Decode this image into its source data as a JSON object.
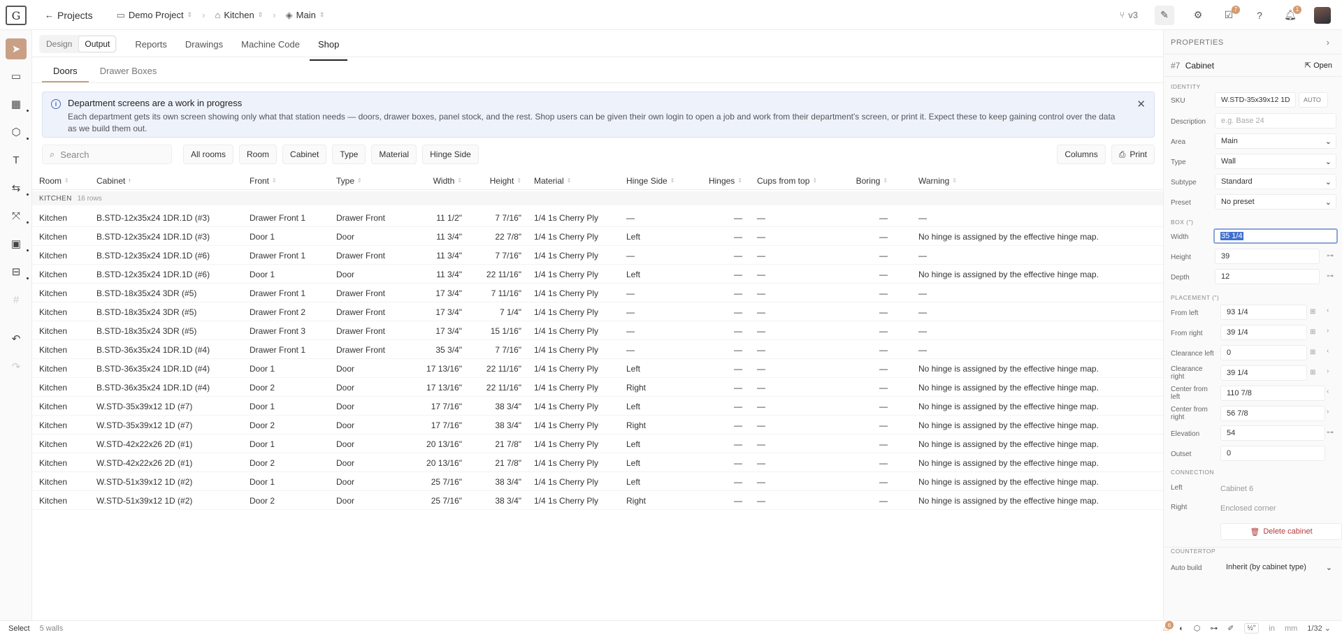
{
  "topbar": {
    "logo": "G",
    "back_label": "Projects",
    "crumbs": [
      "Demo Project",
      "Kitchen",
      "Main"
    ],
    "version": "v3",
    "checklist_badge": "7",
    "notif_badge": "1"
  },
  "toggle": [
    "Design",
    "Output"
  ],
  "tabs": [
    "Reports",
    "Drawings",
    "Machine Code",
    "Shop"
  ],
  "subtabs": [
    "Doors",
    "Drawer Boxes"
  ],
  "banner": {
    "title": "Department screens are a work in progress",
    "text": "Each department gets its own screen showing only what that station needs — doors, drawer boxes, panel stock, and the rest. Shop users can be given their own login to open a job and work from their department's screen, or print it. Expect these to keep gaining control over the data as we build them out."
  },
  "filters": {
    "search_placeholder": "Search",
    "buttons": [
      "All rooms",
      "Room",
      "Cabinet",
      "Type",
      "Material",
      "Hinge Side"
    ],
    "columns_label": "Columns",
    "print_label": "Print"
  },
  "table": {
    "headers": [
      "Room",
      "Cabinet",
      "Front",
      "Type",
      "Width",
      "Height",
      "Material",
      "Hinge Side",
      "Hinges",
      "Cups from top",
      "Boring",
      "Warning"
    ],
    "group": {
      "name": "KITCHEN",
      "count": "16 rows"
    },
    "rows": [
      [
        "Kitchen",
        "B.STD-12x35x24 1DR.1D (#3)",
        "Drawer Front 1",
        "Drawer Front",
        "11 1/2\"",
        "7 7/16\"",
        "1/4 1s Cherry Ply",
        "—",
        "—",
        "—",
        "—",
        "—"
      ],
      [
        "Kitchen",
        "B.STD-12x35x24 1DR.1D (#3)",
        "Door 1",
        "Door",
        "11 3/4\"",
        "22 7/8\"",
        "1/4 1s Cherry Ply",
        "Left",
        "—",
        "—",
        "—",
        "No hinge is assigned by the effective hinge map."
      ],
      [
        "Kitchen",
        "B.STD-12x35x24 1DR.1D (#6)",
        "Drawer Front 1",
        "Drawer Front",
        "11 3/4\"",
        "7 7/16\"",
        "1/4 1s Cherry Ply",
        "—",
        "—",
        "—",
        "—",
        "—"
      ],
      [
        "Kitchen",
        "B.STD-12x35x24 1DR.1D (#6)",
        "Door 1",
        "Door",
        "11 3/4\"",
        "22 11/16\"",
        "1/4 1s Cherry Ply",
        "Left",
        "—",
        "—",
        "—",
        "No hinge is assigned by the effective hinge map."
      ],
      [
        "Kitchen",
        "B.STD-18x35x24 3DR (#5)",
        "Drawer Front 1",
        "Drawer Front",
        "17 3/4\"",
        "7 11/16\"",
        "1/4 1s Cherry Ply",
        "—",
        "—",
        "—",
        "—",
        "—"
      ],
      [
        "Kitchen",
        "B.STD-18x35x24 3DR (#5)",
        "Drawer Front 2",
        "Drawer Front",
        "17 3/4\"",
        "7 1/4\"",
        "1/4 1s Cherry Ply",
        "—",
        "—",
        "—",
        "—",
        "—"
      ],
      [
        "Kitchen",
        "B.STD-18x35x24 3DR (#5)",
        "Drawer Front 3",
        "Drawer Front",
        "17 3/4\"",
        "15 1/16\"",
        "1/4 1s Cherry Ply",
        "—",
        "—",
        "—",
        "—",
        "—"
      ],
      [
        "Kitchen",
        "B.STD-36x35x24 1DR.1D (#4)",
        "Drawer Front 1",
        "Drawer Front",
        "35 3/4\"",
        "7 7/16\"",
        "1/4 1s Cherry Ply",
        "—",
        "—",
        "—",
        "—",
        "—"
      ],
      [
        "Kitchen",
        "B.STD-36x35x24 1DR.1D (#4)",
        "Door 1",
        "Door",
        "17 13/16\"",
        "22 11/16\"",
        "1/4 1s Cherry Ply",
        "Left",
        "—",
        "—",
        "—",
        "No hinge is assigned by the effective hinge map."
      ],
      [
        "Kitchen",
        "B.STD-36x35x24 1DR.1D (#4)",
        "Door 2",
        "Door",
        "17 13/16\"",
        "22 11/16\"",
        "1/4 1s Cherry Ply",
        "Right",
        "—",
        "—",
        "—",
        "No hinge is assigned by the effective hinge map."
      ],
      [
        "Kitchen",
        "W.STD-35x39x12 1D (#7)",
        "Door 1",
        "Door",
        "17 7/16\"",
        "38 3/4\"",
        "1/4 1s Cherry Ply",
        "Left",
        "—",
        "—",
        "—",
        "No hinge is assigned by the effective hinge map."
      ],
      [
        "Kitchen",
        "W.STD-35x39x12 1D (#7)",
        "Door 2",
        "Door",
        "17 7/16\"",
        "38 3/4\"",
        "1/4 1s Cherry Ply",
        "Right",
        "—",
        "—",
        "—",
        "No hinge is assigned by the effective hinge map."
      ],
      [
        "Kitchen",
        "W.STD-42x22x26 2D (#1)",
        "Door 1",
        "Door",
        "20 13/16\"",
        "21 7/8\"",
        "1/4 1s Cherry Ply",
        "Left",
        "—",
        "—",
        "—",
        "No hinge is assigned by the effective hinge map."
      ],
      [
        "Kitchen",
        "W.STD-42x22x26 2D (#1)",
        "Door 2",
        "Door",
        "20 13/16\"",
        "21 7/8\"",
        "1/4 1s Cherry Ply",
        "Left",
        "—",
        "—",
        "—",
        "No hinge is assigned by the effective hinge map."
      ],
      [
        "Kitchen",
        "W.STD-51x39x12 1D (#2)",
        "Door 1",
        "Door",
        "25 7/16\"",
        "38 3/4\"",
        "1/4 1s Cherry Ply",
        "Left",
        "—",
        "—",
        "—",
        "No hinge is assigned by the effective hinge map."
      ],
      [
        "Kitchen",
        "W.STD-51x39x12 1D (#2)",
        "Door 2",
        "Door",
        "25 7/16\"",
        "38 3/4\"",
        "1/4 1s Cherry Ply",
        "Right",
        "—",
        "—",
        "—",
        "No hinge is assigned by the effective hinge map."
      ]
    ]
  },
  "props": {
    "header": "PROPERTIES",
    "object_num": "#7",
    "object_name": "Cabinet",
    "open_label": "Open",
    "identity_section": "IDENTITY",
    "sku_label": "SKU",
    "sku_value": "W.STD-35x39x12 1D",
    "sku_auto": "AUTO",
    "description_label": "Description",
    "description_placeholder": "e.g. Base 24",
    "area_label": "Area",
    "area_value": "Main",
    "type_label": "Type",
    "type_value": "Wall",
    "subtype_label": "Subtype",
    "subtype_value": "Standard",
    "preset_label": "Preset",
    "preset_value": "No preset",
    "box_section": "BOX (\")",
    "width_label": "Width",
    "width_value": "35 1/4",
    "height_label": "Height",
    "height_value": "39",
    "depth_label": "Depth",
    "depth_value": "12",
    "placement_section": "PLACEMENT (\")",
    "from_left_label": "From left",
    "from_left_value": "93 1/4",
    "from_right_label": "From right",
    "from_right_value": "39 1/4",
    "clear_left_label": "Clearance left",
    "clear_left_value": "0",
    "clear_right_label": "Clearance right",
    "clear_right_value": "39 1/4",
    "center_left_label": "Center from left",
    "center_left_value": "110 7/8",
    "center_right_label": "Center from right",
    "center_right_value": "56 7/8",
    "elevation_label": "Elevation",
    "elevation_value": "54",
    "outset_label": "Outset",
    "outset_value": "0",
    "connection_section": "CONNECTION",
    "conn_left_label": "Left",
    "conn_left_value": "Cabinet 6",
    "conn_right_label": "Right",
    "conn_right_value": "Enclosed corner",
    "delete_label": "Delete cabinet",
    "countertop_section": "COUNTERTOP",
    "auto_build_label": "Auto build",
    "auto_build_value": "Inherit (by cabinet type)"
  },
  "status": {
    "mode": "Select",
    "walls": "5 walls",
    "fraction": "½\"",
    "unit_in": "in",
    "unit_mm": "mm",
    "precision": "1/32",
    "alert_badge": "6"
  },
  "colors": {
    "accent": "#c9a085",
    "banner_bg": "#eef2fb",
    "danger": "#b43b3b"
  }
}
